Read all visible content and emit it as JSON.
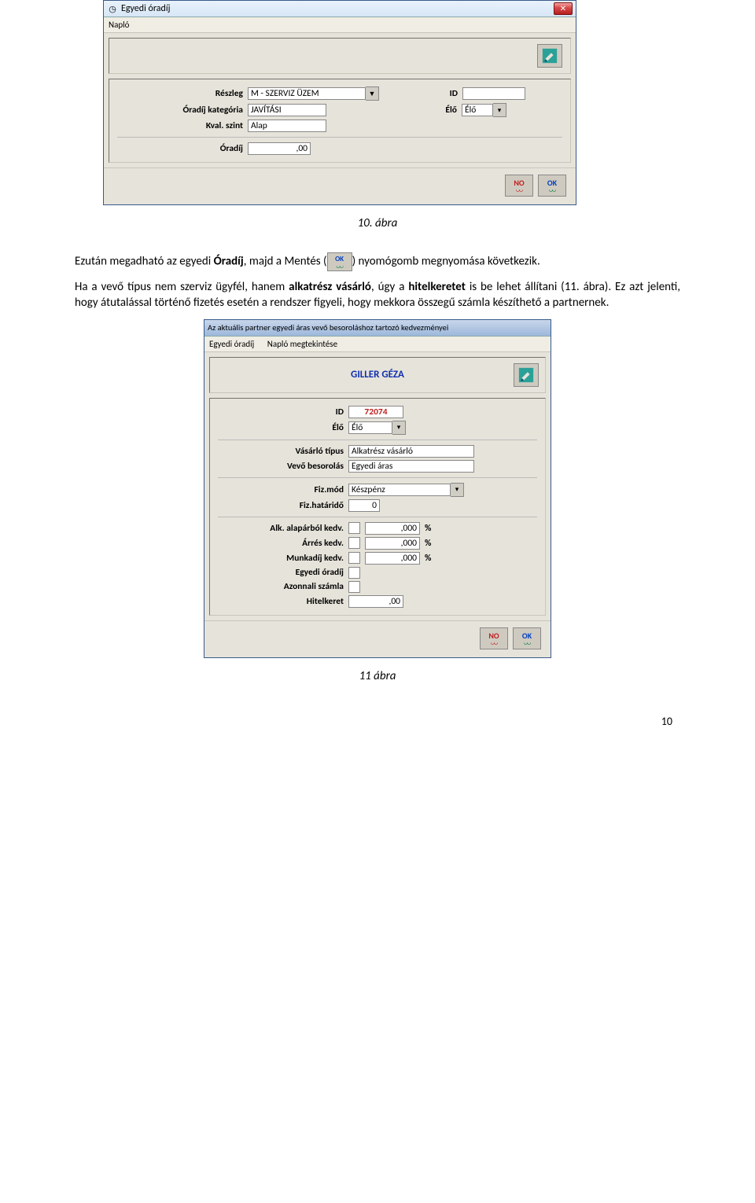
{
  "win1": {
    "title": "Egyedi óradíj",
    "menu": "Napló",
    "labels": {
      "reszleg": "Részleg",
      "kategoria": "Óradíj kategória",
      "kval": "Kval. szint",
      "oradij": "Óradíj",
      "id": "ID",
      "elo": "Élő"
    },
    "values": {
      "reszleg": "M - SZERVIZ ÜZEM",
      "kategoria": "JAVÍTÁSI",
      "kval": "Alap",
      "oradij": ",00",
      "id": "",
      "elo": "Élő"
    },
    "buttons": {
      "no": "NO",
      "ok": "OK"
    }
  },
  "caption1": "10. ábra",
  "para1": {
    "pre": "Ezután megadható az egyedi ",
    "bold1": "Óradíj",
    "mid": ", majd a Mentés (",
    "post": ") nyomógomb megnyomása következik."
  },
  "para2_a": "Ha a vevő típus nem szerviz ügyfél, hanem ",
  "para2_b": "alkatrész vásárló",
  "para2_c": ", úgy a ",
  "para2_d": "hitelkeretet",
  "para2_e": " is be lehet állítani (11. ábra). Ez azt jelenti, hogy átutalással történő fizetés esetén a rendszer figyeli, hogy mekkora összegű számla készíthető a partnernek.",
  "win2": {
    "title": "Az aktuális partner egyedi áras vevő besoroláshoz tartozó kedvezményei",
    "menu1": "Egyedi óradíj",
    "menu2": "Napló megtekintése",
    "partner": "GILLER GÉZA",
    "labels": {
      "id": "ID",
      "elo": "Élő",
      "vtipus": "Vásárló típus",
      "vbes": "Vevő besorolás",
      "fizmod": "Fiz.mód",
      "fizhat": "Fiz.határidő",
      "alk": "Alk. alapárból kedv.",
      "arres": "Árrés kedv.",
      "munka": "Munkadíj kedv.",
      "egyedi": "Egyedi óradíj",
      "azonnali": "Azonnali számla",
      "hitel": "Hitelkeret"
    },
    "values": {
      "id": "72074",
      "elo": "Élő",
      "vtipus": "Alkatrész vásárló",
      "vbes": "Egyedi áras",
      "fizmod": "Készpénz",
      "fizhat": "0",
      "alk": ",000",
      "arres": ",000",
      "munka": ",000",
      "hitel": ",00"
    },
    "pct": "%",
    "buttons": {
      "no": "NO",
      "ok": "OK"
    }
  },
  "caption2": "11 ábra",
  "pagenum": "10"
}
